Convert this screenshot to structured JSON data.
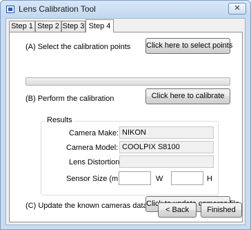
{
  "window": {
    "title": "Lens Calibration Tool",
    "close_label": "✕"
  },
  "tabs": [
    {
      "label": "Step 1"
    },
    {
      "label": "Step 2"
    },
    {
      "label": "Step 3"
    },
    {
      "label": "Step 4",
      "active": true
    }
  ],
  "step_a": {
    "label": "(A) Select the calibration points",
    "button_label": "Click here to select points"
  },
  "progress": {
    "fraction": 0.0
  },
  "step_b": {
    "label": "(B) Perform the calibration",
    "button_label": "Click here to calibrate"
  },
  "results": {
    "title": "Results",
    "camera_make_label": "Camera Make:",
    "camera_make_value": "NIKON",
    "camera_model_label": "Camera Model:",
    "camera_model_value": "COOLPIX S8100",
    "lens_distortion_label": "Lens Distortion:",
    "lens_distortion_value": "",
    "sensor_size_label": "Sensor Size (mm):",
    "sensor_width_value": "",
    "sensor_width_unit": "W",
    "sensor_height_value": "",
    "sensor_height_unit": "H"
  },
  "step_c": {
    "label": "(C) Update the known cameras data file",
    "button_label": "Click to update cameras file"
  },
  "nav": {
    "back_label": "< Back",
    "finished_label": "Finished"
  },
  "colors": {
    "titlebar": "#c9dcef",
    "progress_fill": "#4bbd42"
  }
}
